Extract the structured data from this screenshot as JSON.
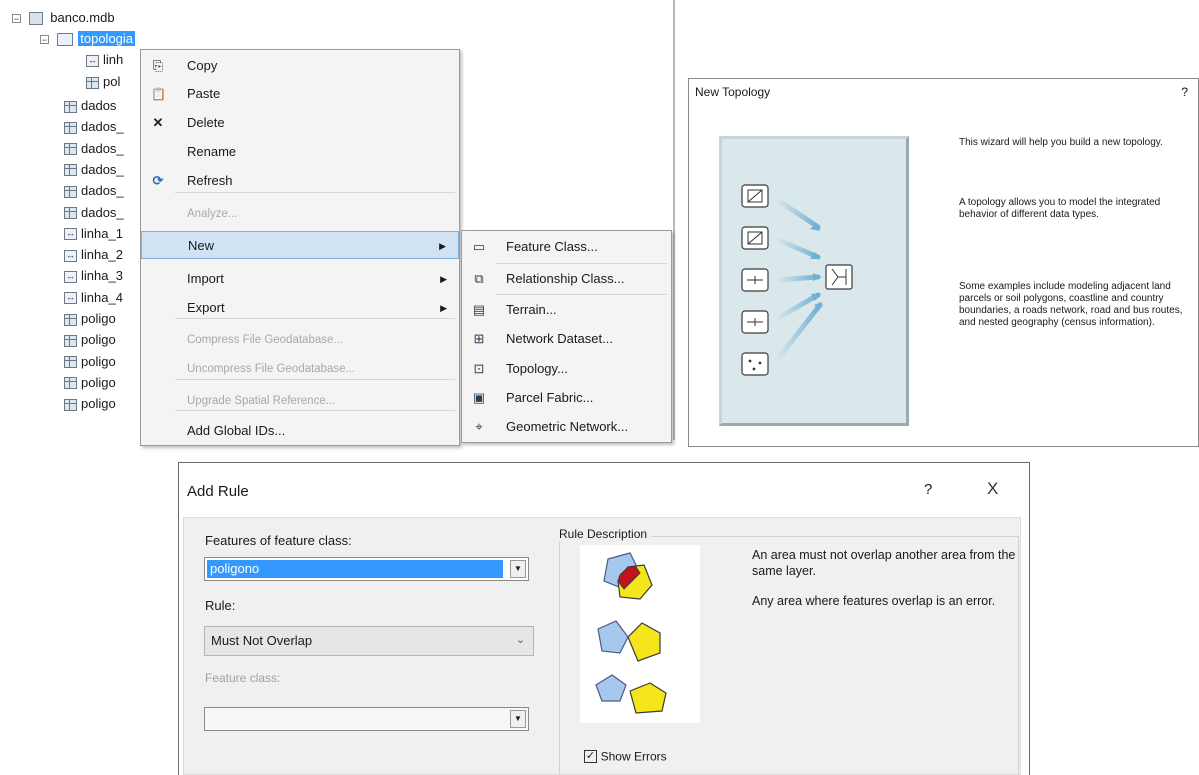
{
  "tree": {
    "root": "banco.mdb",
    "selected": "topologia",
    "children": [
      "linh",
      "pol"
    ],
    "items": [
      "dados",
      "dados_",
      "dados_",
      "dados_",
      "dados_",
      "dados_",
      "linha_1",
      "linha_2",
      "linha_3",
      "linha_4",
      "poligo",
      "poligo",
      "poligo",
      "poligo",
      "poligo"
    ]
  },
  "context_menu": {
    "items": [
      {
        "label": "Copy",
        "icon": "copy-icon"
      },
      {
        "label": "Paste",
        "icon": "paste-icon"
      },
      {
        "label": "Delete",
        "icon": "delete-icon"
      },
      {
        "label": "Rename",
        "icon": ""
      },
      {
        "label": "Refresh",
        "icon": "refresh-icon"
      },
      {
        "label": "Analyze...",
        "icon": ""
      },
      {
        "label": "New",
        "icon": ""
      },
      {
        "label": "Import",
        "icon": ""
      },
      {
        "label": "Export",
        "icon": ""
      },
      {
        "label": "Compress File Geodatabase...",
        "icon": ""
      },
      {
        "label": "Uncompress File Geodatabase...",
        "icon": ""
      },
      {
        "label": "Upgrade Spatial Reference...",
        "icon": ""
      },
      {
        "label": "Add Global IDs...",
        "icon": ""
      }
    ]
  },
  "submenu": {
    "items": [
      {
        "label": "Feature Class...",
        "icon": "feature-class-icon"
      },
      {
        "label": "Relationship Class...",
        "icon": "relationship-class-icon"
      },
      {
        "label": "Terrain...",
        "icon": "terrain-icon"
      },
      {
        "label": "Network Dataset...",
        "icon": "network-dataset-icon"
      },
      {
        "label": "Topology...",
        "icon": "topology-icon"
      },
      {
        "label": "Parcel Fabric...",
        "icon": "parcel-fabric-icon"
      },
      {
        "label": "Geometric Network...",
        "icon": "geometric-network-icon"
      }
    ]
  },
  "new_topology": {
    "title": "New Topology",
    "help": "?",
    "text1": "This wizard will help you build a new topology.",
    "text2": "A topology allows you to model the integrated behavior of different data types.",
    "text3": "Some examples include modeling adjacent land parcels or soil polygons, coastline and country boundaries, a roads network, road and bus routes, and nested geography (census information)."
  },
  "add_rule": {
    "title": "Add Rule",
    "help": "?",
    "close": "X",
    "features_label": "Features of feature class:",
    "features_value": "poligono",
    "rule_label": "Rule:",
    "rule_value": "Must Not Overlap",
    "feature_class_label": "Feature class:",
    "feature_class_value": "",
    "rule_description_label": "Rule Description",
    "desc1": "An area must not overlap another area from the same layer.",
    "desc2": "Any area where features overlap is an error.",
    "show_errors_label": "Show Errors",
    "show_errors_checked": true
  },
  "colors": {
    "selection": "#3399ff",
    "menu_highlight": "#cfe3f5",
    "polygon_blue": "#a7c8ee",
    "polygon_yellow": "#f5e61c",
    "overlap_red": "#c0141c"
  }
}
